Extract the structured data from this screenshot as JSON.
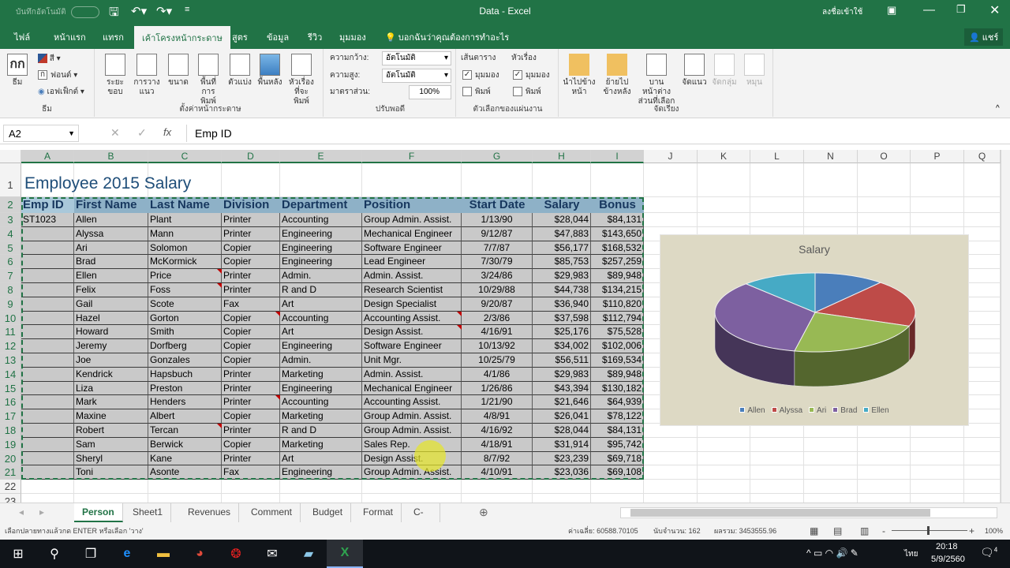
{
  "titlebar": {
    "autosave": "บันทึกอัตโนมัติ",
    "title": "Data  -  Excel",
    "sign_in": "ลงชื่อเข้าใช้"
  },
  "tabs": [
    {
      "label": "ไฟล์"
    },
    {
      "label": "หน้าแรก"
    },
    {
      "label": "แทรก"
    },
    {
      "label": "เค้าโครงหน้ากระดาษ",
      "active": true
    },
    {
      "label": "สูตร"
    },
    {
      "label": "ข้อมูล"
    },
    {
      "label": "รีวิว"
    },
    {
      "label": "มุมมอง"
    }
  ],
  "tell_me": "บอกฉันว่าคุณต้องการทำอะไร",
  "share": "แชร์",
  "ribbon": {
    "themes": {
      "label": "ธีม",
      "themes": "ธีม",
      "colors": "สี",
      "fonts": "ฟอนต์",
      "effects": "เอฟเฟ็กต์"
    },
    "page_setup": {
      "label": "ตั้งค่าหน้ากระดาษ",
      "buttons": [
        "ระยะขอบ",
        "การวางแนว",
        "ขนาด",
        "พื้นที่การพิมพ์",
        "ตัวแบ่ง",
        "พื้นหลัง",
        "หัวเรื่องที่จะพิมพ์"
      ]
    },
    "scale": {
      "label": "ปรับพอดี",
      "width_label": "ความกว้าง:",
      "width_value": "อัตโนมัติ",
      "height_label": "ความสูง:",
      "height_value": "อัตโนมัติ",
      "scale_label": "มาตราส่วน:",
      "scale_value": "100%"
    },
    "sheet_options": {
      "label": "ตัวเลือกของแผ่นงาน",
      "gridlines": "เส้นตาราง",
      "headings": "หัวเรื่อง",
      "view": "มุมมอง",
      "print": "พิมพ์",
      "gridlines_view": true,
      "gridlines_print": false,
      "headings_view": true,
      "headings_print": false
    },
    "arrange": {
      "label": "จัดเรียง",
      "buttons": [
        "นำไปข้างหน้า",
        "ย้ายไปข้างหลัง",
        "บานหน้าต่างส่วนที่เลือก",
        "จัดแนว",
        "จัดกลุ่ม",
        "หมุน"
      ]
    }
  },
  "formula_bar": {
    "name_box": "A2",
    "fx": "fx",
    "value": "Emp ID"
  },
  "columns": [
    "A",
    "B",
    "C",
    "D",
    "E",
    "F",
    "G",
    "H",
    "I",
    "J",
    "K",
    "L",
    "N",
    "O",
    "P",
    "Q"
  ],
  "sheet": {
    "title": "Employee 2015 Salary",
    "headers": [
      "Emp ID",
      "First Name",
      "Last Name",
      "Division",
      "Department",
      "Position",
      "Start Date",
      "Salary",
      "Bonus"
    ],
    "rows": [
      [
        "ST1023",
        "Allen",
        "Plant",
        "Printer",
        "Accounting",
        "Group Admin. Assist.",
        "1/13/90",
        "$28,044",
        "$84,131"
      ],
      [
        "",
        "Alyssa",
        "Mann",
        "Printer",
        "Engineering",
        "Mechanical Engineer",
        "9/12/87",
        "$47,883",
        "$143,650"
      ],
      [
        "",
        "Ari",
        "Solomon",
        "Copier",
        "Engineering",
        "Software Engineer",
        "7/7/87",
        "$56,177",
        "$168,532"
      ],
      [
        "",
        "Brad",
        "McKormick",
        "Copier",
        "Engineering",
        "Lead Engineer",
        "7/30/79",
        "$85,753",
        "$257,259"
      ],
      [
        "",
        "Ellen",
        "Price",
        "Printer",
        "Admin.",
        "Admin. Assist.",
        "3/24/86",
        "$29,983",
        "$89,948"
      ],
      [
        "",
        "Felix",
        "Foss",
        "Printer",
        "R and D",
        "Research Scientist",
        "10/29/88",
        "$44,738",
        "$134,215"
      ],
      [
        "",
        "Gail",
        "Scote",
        "Fax",
        "Art",
        "Design Specialist",
        "9/20/87",
        "$36,940",
        "$110,820"
      ],
      [
        "",
        "Hazel",
        "Gorton",
        "Copier",
        "Accounting",
        "Accounting Assist.",
        "2/3/86",
        "$37,598",
        "$112,794"
      ],
      [
        "",
        "Howard",
        "Smith",
        "Copier",
        "Art",
        "Design Assist.",
        "4/16/91",
        "$25,176",
        "$75,528"
      ],
      [
        "",
        "Jeremy",
        "Dorfberg",
        "Copier",
        "Engineering",
        "Software Engineer",
        "10/13/92",
        "$34,002",
        "$102,006"
      ],
      [
        "",
        "Joe",
        "Gonzales",
        "Copier",
        "Admin.",
        "Unit Mgr.",
        "10/25/79",
        "$56,511",
        "$169,534"
      ],
      [
        "",
        "Kendrick",
        "Hapsbuch",
        "Printer",
        "Marketing",
        "Admin. Assist.",
        "4/1/86",
        "$29,983",
        "$89,948"
      ],
      [
        "",
        "Liza",
        "Preston",
        "Printer",
        "Engineering",
        "Mechanical Engineer",
        "1/26/86",
        "$43,394",
        "$130,182"
      ],
      [
        "",
        "Mark",
        "Henders",
        "Printer",
        "Accounting",
        "Accounting Assist.",
        "1/21/90",
        "$21,646",
        "$64,939"
      ],
      [
        "",
        "Maxine",
        "Albert",
        "Copier",
        "Marketing",
        "Group Admin. Assist.",
        "4/8/91",
        "$26,041",
        "$78,122"
      ],
      [
        "",
        "Robert",
        "Tercan",
        "Printer",
        "R and D",
        "Group Admin. Assist.",
        "4/16/92",
        "$28,044",
        "$84,131"
      ],
      [
        "",
        "Sam",
        "Berwick",
        "Copier",
        "Marketing",
        "Sales Rep.",
        "4/18/91",
        "$31,914",
        "$95,742"
      ],
      [
        "",
        "Sheryl",
        "Kane",
        "Printer",
        "Art",
        "Design Assist.",
        "8/7/92",
        "$23,239",
        "$69,718"
      ],
      [
        "",
        "Toni",
        "Asonte",
        "Fax",
        "Engineering",
        "Group Admin. Assist.",
        "4/10/91",
        "$23,036",
        "$69,108"
      ]
    ]
  },
  "chart_data": {
    "type": "pie",
    "title": "Salary",
    "categories": [
      "Allen",
      "Alyssa",
      "Ari",
      "Brad",
      "Ellen"
    ],
    "values": [
      28044,
      47883,
      56177,
      85753,
      29983
    ],
    "colors": [
      "#4a7ebb",
      "#be4b48",
      "#98b954",
      "#7d60a0",
      "#46aac5"
    ],
    "style": "3d",
    "legend": "bottom"
  },
  "sheet_tabs": [
    {
      "label": "Person",
      "active": true
    },
    {
      "label": "Sheet1"
    },
    {
      "label": "Revenues"
    },
    {
      "label": "Comment"
    },
    {
      "label": "Budget"
    },
    {
      "label": "Format"
    },
    {
      "label": "C-Line"
    }
  ],
  "status": {
    "message": "เลือกปลายทางแล้วกด ENTER หรือเลือก 'วาง'",
    "average": "ค่าเฉลี่ย: 60588.70105",
    "count": "นับจำนวน: 162",
    "sum": "ผลรวม: 3453555.96",
    "zoom": "100%"
  },
  "taskbar": {
    "time": "20:18",
    "date": "5/9/2560",
    "lang": "ไทย",
    "notifications": "4"
  }
}
